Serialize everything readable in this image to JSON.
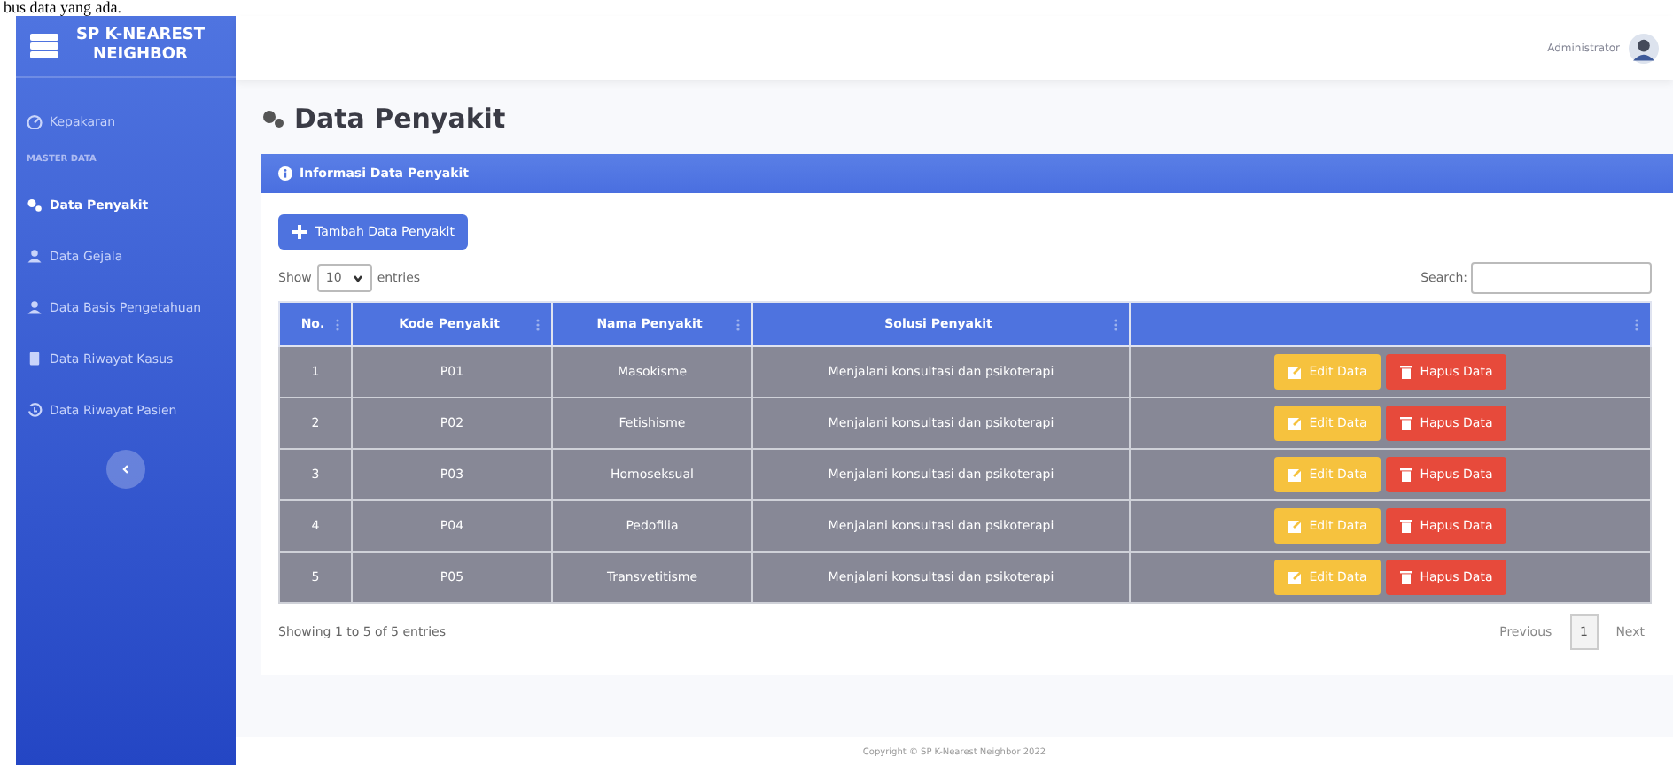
{
  "document_text": "bus data yang ada.",
  "sidebar": {
    "brand": [
      "SP K-NEAREST",
      "NEIGHBOR"
    ],
    "items": [
      {
        "kind": "item",
        "label": "Kepakaran",
        "selected": false
      },
      {
        "kind": "heading",
        "label": "MASTER DATA"
      },
      {
        "kind": "item",
        "label": "Data Penyakit",
        "selected": true
      },
      {
        "kind": "item",
        "label": "Data Gejala",
        "selected": false
      },
      {
        "kind": "item",
        "label": "Data Basis Pengetahuan",
        "selected": false
      },
      {
        "kind": "item",
        "label": "Data Riwayat Kasus",
        "selected": false
      },
      {
        "kind": "item",
        "label": "Data Riwayat Pasien",
        "selected": false
      }
    ]
  },
  "topbar": {
    "user": "Administrator"
  },
  "page_title": "Data Penyakit",
  "card": {
    "title": "Informasi Data Penyakit",
    "add_button": "Tambah Data Penyakit",
    "show_label": "Show",
    "page_size": "10",
    "entries_label": "entries",
    "search_label": "Search:",
    "table": {
      "columns": [
        "No.",
        "Kode Penyakit",
        "Nama Penyakit",
        "Solusi Penyakit"
      ],
      "rows": [
        {
          "no": "1",
          "kode": "P01",
          "nama": "Masokisme",
          "solusi": "Menjalani konsultasi dan psikoterapi",
          "edit": "Edit Data",
          "delete": "Hapus Data"
        },
        {
          "no": "2",
          "kode": "P02",
          "nama": "Fetishisme",
          "solusi": "Menjalani konsultasi dan psikoterapi",
          "edit": "Edit Data",
          "delete": "Hapus Data"
        },
        {
          "no": "3",
          "kode": "P03",
          "nama": "Homoseksual",
          "solusi": "Menjalani konsultasi dan psikoterapi",
          "edit": "Edit Data",
          "delete": "Hapus Data"
        },
        {
          "no": "4",
          "kode": "P04",
          "nama": "Pedofilia",
          "solusi": "Menjalani konsultasi dan psikoterapi",
          "edit": "Edit Data",
          "delete": "Hapus Data"
        },
        {
          "no": "5",
          "kode": "P05",
          "nama": "Transvetitisme",
          "solusi": "Menjalani konsultasi dan psikoterapi",
          "edit": "Edit Data",
          "delete": "Hapus Data"
        }
      ]
    },
    "info": "Showing 1 to 5 of 5 entries",
    "pagination": {
      "previous": "Previous",
      "pages": [
        {
          "label": "1",
          "selected": true
        }
      ],
      "next": "Next"
    }
  },
  "footer": "Copyright © SP K-Nearest Neighbor 2022"
}
